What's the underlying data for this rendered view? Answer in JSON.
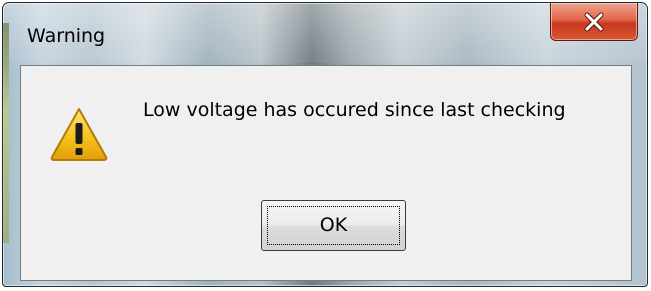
{
  "window": {
    "title": "Warning"
  },
  "titlebar": {
    "close_icon": "close-icon"
  },
  "dialog": {
    "icon": "warning-icon",
    "message": "Low voltage has occured since last checking",
    "ok_label": "OK"
  },
  "colors": {
    "close_button": "#d8553a",
    "client_background": "#f0f0f0",
    "warning_fill": "#f6c21c"
  }
}
